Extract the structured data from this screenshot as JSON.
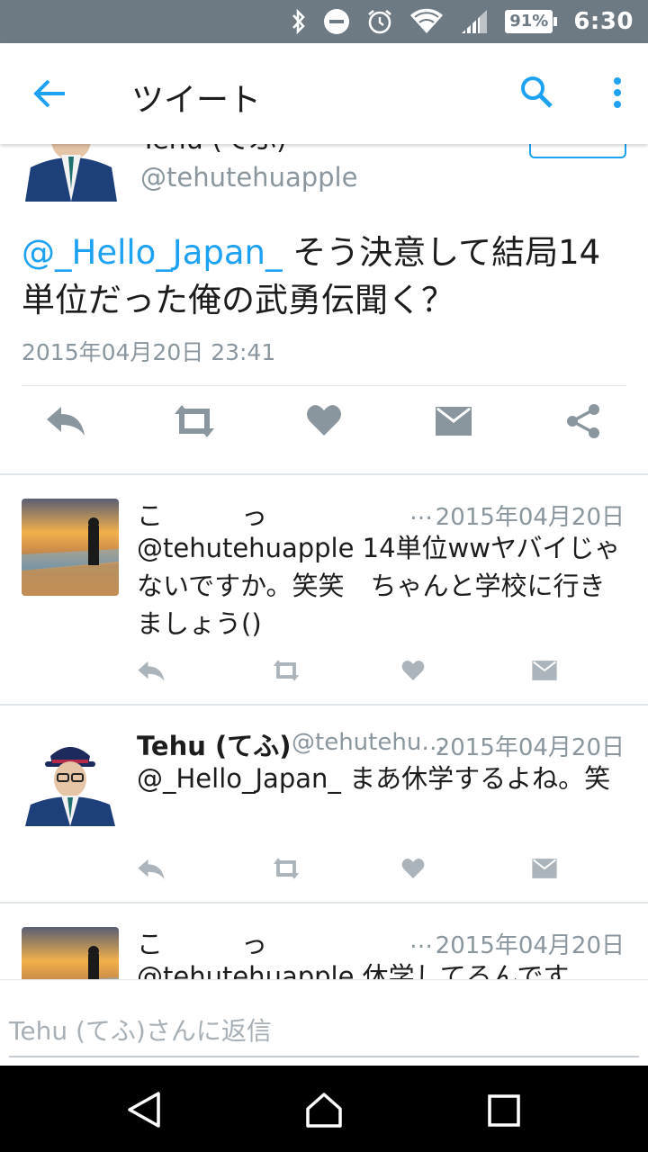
{
  "status_bar": {
    "battery": "91%",
    "time": "6:30",
    "icons": [
      "bluetooth-icon",
      "do-not-disturb-icon",
      "alarm-icon",
      "wifi-icon",
      "signal-icon",
      "battery-icon"
    ]
  },
  "app_bar": {
    "title": "ツイート",
    "icons": [
      "back-arrow-icon",
      "search-icon",
      "more-vert-icon"
    ]
  },
  "main_tweet": {
    "name": "Tehu (てふ)",
    "handle": "@tehutehuapple",
    "mention": "@_Hello_Japan_",
    "text": " そう決意して結局14単位だった俺の武勇伝聞く？",
    "date": "2015年04月20日 23:41",
    "actions": [
      "reply-icon",
      "retweet-icon",
      "like-icon",
      "message-icon",
      "share-icon"
    ]
  },
  "replies": [
    {
      "name": "こ　　　っ",
      "handle": "…",
      "date": "2015年04月20日",
      "text": "@tehutehuapple 14単位wwヤバイじゃないですか。笑笑　ちゃんと学校に行きましょう()"
    },
    {
      "name": "Tehu (てふ)",
      "handle": "@tehutehu…",
      "date": "2015年04月20日",
      "text": "@_Hello_Japan_ まあ休学するよね。笑"
    },
    {
      "name": "こ　　　っ",
      "handle": "…",
      "date": "2015年04月20日",
      "text": "@tehutehuapple 休学してるんです"
    }
  ],
  "reply_input": {
    "placeholder": "Tehu (てふ)さんに返信"
  },
  "colors": {
    "accent": "#1da1f2",
    "status_bar": "#6d7a84",
    "action_gray": "#8a969e",
    "text": "#1c1c1c"
  }
}
